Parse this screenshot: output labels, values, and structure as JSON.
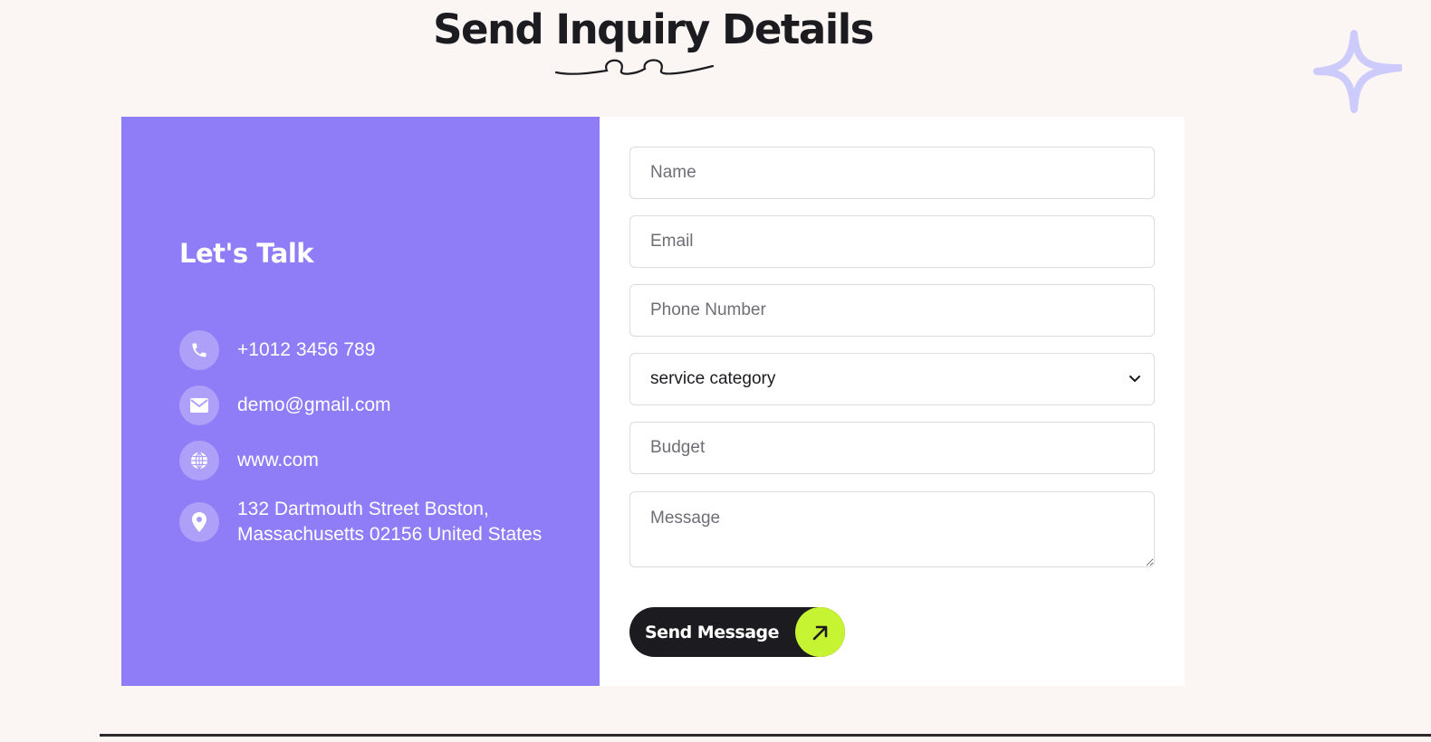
{
  "heading": "Send Inquiry Details",
  "info": {
    "title": "Let's Talk",
    "phone": "+1012 3456 789",
    "email": "demo@gmail.com",
    "website": "www.com",
    "address_line1": "132 Dartmouth Street Boston,",
    "address_line2": "Massachusetts 02156 United States"
  },
  "form": {
    "name_placeholder": "Name",
    "email_placeholder": "Email",
    "phone_placeholder": "Phone Number",
    "service_selected": "service category",
    "budget_placeholder": "Budget",
    "message_placeholder": "Message",
    "submit_label": "Send Message"
  },
  "colors": {
    "accent_purple": "#8f7cf7",
    "button_dark": "#1c1b1f",
    "arrow_lime": "#c6f432",
    "page_bg": "#fbf5f4"
  },
  "icons": [
    "phone-icon",
    "mail-icon",
    "globe-icon",
    "location-pin-icon",
    "arrow-up-right-icon",
    "chevron-down-icon",
    "sparkle-icon",
    "squiggle-underline"
  ]
}
